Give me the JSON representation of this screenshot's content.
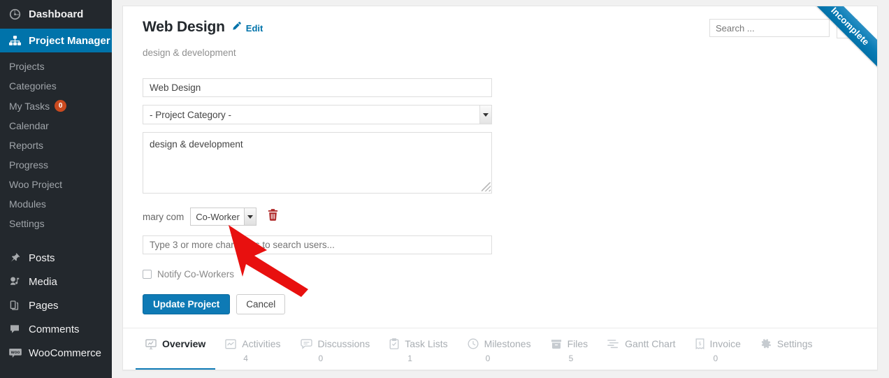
{
  "sidebar": {
    "dashboard": {
      "label": "Dashboard",
      "icon": "dashboard-icon"
    },
    "active": {
      "label": "Project Manager",
      "icon": "sitemap-icon"
    },
    "submenu": [
      {
        "label": "Projects"
      },
      {
        "label": "Categories"
      },
      {
        "label": "My Tasks",
        "badge": "0"
      },
      {
        "label": "Calendar"
      },
      {
        "label": "Reports"
      },
      {
        "label": "Progress"
      },
      {
        "label": "Woo Project"
      },
      {
        "label": "Modules"
      },
      {
        "label": "Settings"
      }
    ],
    "wp_items": [
      {
        "label": "Posts",
        "icon": "pin-icon"
      },
      {
        "label": "Media",
        "icon": "media-icon"
      },
      {
        "label": "Pages",
        "icon": "pages-icon"
      },
      {
        "label": "Comments",
        "icon": "comment-icon"
      },
      {
        "label": "WooCommerce",
        "icon": "woo-icon"
      }
    ]
  },
  "header": {
    "title": "Web Design",
    "edit_label": "Edit",
    "subtitle": "design & development",
    "ribbon_label": "Incomplete"
  },
  "search": {
    "placeholder": "Search ...",
    "value": ""
  },
  "form": {
    "project_name": "Web Design",
    "category_selected": "- Project Category -",
    "description": "design & development",
    "coworker_name": "mary com",
    "coworker_role": "Co-Worker",
    "user_search_placeholder": "Type 3 or more characters to search users...",
    "notify_label": "Notify Co-Workers",
    "notify_checked": false,
    "update_label": "Update Project",
    "cancel_label": "Cancel"
  },
  "tabs": [
    {
      "label": "Overview",
      "count": "",
      "icon": "monitor-chart-icon",
      "active": true
    },
    {
      "label": "Activities",
      "count": "4",
      "icon": "activity-icon",
      "active": false
    },
    {
      "label": "Discussions",
      "count": "0",
      "icon": "chat-icon",
      "active": false
    },
    {
      "label": "Task Lists",
      "count": "1",
      "icon": "clipboard-icon",
      "active": false
    },
    {
      "label": "Milestones",
      "count": "0",
      "icon": "clock-icon",
      "active": false
    },
    {
      "label": "Files",
      "count": "5",
      "icon": "box-icon",
      "active": false
    },
    {
      "label": "Gantt Chart",
      "count": "",
      "icon": "gantt-icon",
      "active": false
    },
    {
      "label": "Invoice",
      "count": "0",
      "icon": "receipt-icon",
      "active": false
    },
    {
      "label": "Settings",
      "count": "",
      "icon": "gear-icon",
      "active": false
    }
  ],
  "colors": {
    "sidebar_bg": "#23282d",
    "accent_blue": "#0073aa",
    "button_blue": "#0e7ab5",
    "badge_orange": "#ca4a1f",
    "ribbon_blue": "#0a7cb5",
    "trash_red": "#b02b2b",
    "arrow_red": "#e8100f"
  },
  "annotation": {
    "name": "red-arrow-pointer"
  }
}
